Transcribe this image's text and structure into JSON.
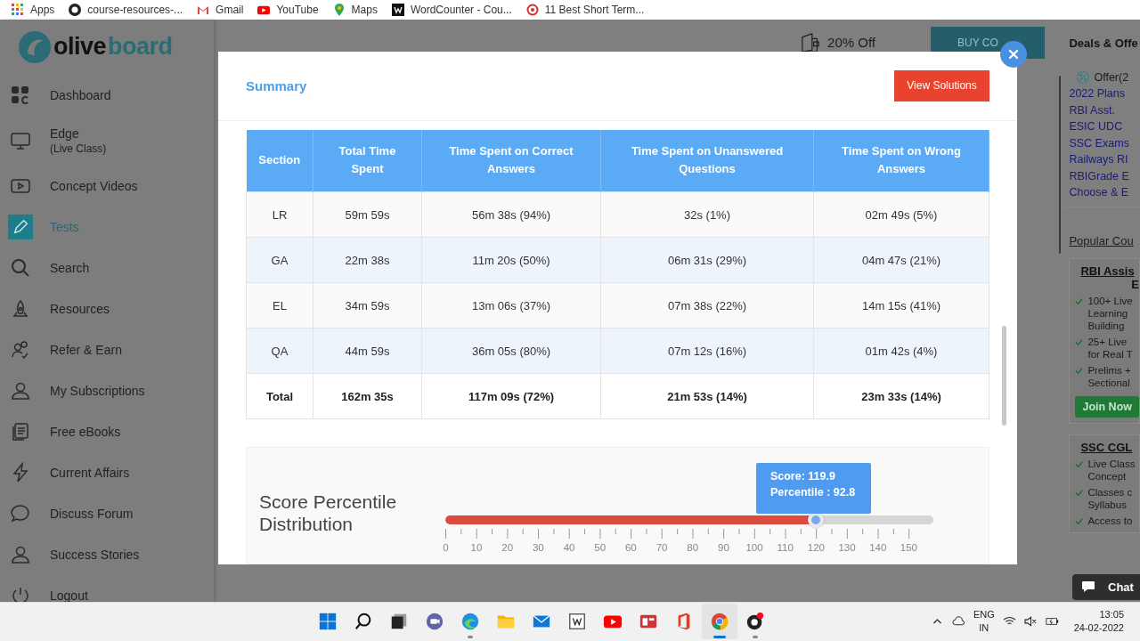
{
  "bookmarks": [
    {
      "label": "Apps",
      "kind": "apps"
    },
    {
      "label": "course-resources-...",
      "kind": "github"
    },
    {
      "label": "Gmail",
      "kind": "gmail"
    },
    {
      "label": "YouTube",
      "kind": "youtube"
    },
    {
      "label": "Maps",
      "kind": "maps"
    },
    {
      "label": "WordCounter - Cou...",
      "kind": "wordcounter"
    },
    {
      "label": "11 Best Short Term...",
      "kind": "target"
    }
  ],
  "logo": [
    "olive",
    "board"
  ],
  "sidebar": {
    "items": [
      {
        "label": "Dashboard",
        "kind": "grid",
        "selected": false
      },
      {
        "label": "Edge",
        "sublabel": "(Live Class)",
        "kind": "monitor",
        "selected": false
      },
      {
        "label": "Concept Videos",
        "kind": "video",
        "selected": false
      },
      {
        "label": "Tests",
        "kind": "pencil",
        "selected": true
      },
      {
        "label": "Search",
        "kind": "search",
        "selected": false
      },
      {
        "label": "Resources",
        "kind": "rocket",
        "selected": false
      },
      {
        "label": "Refer & Earn",
        "kind": "people",
        "selected": false
      },
      {
        "label": "My Subscriptions",
        "kind": "person",
        "selected": false
      },
      {
        "label": "Free eBooks",
        "kind": "book",
        "selected": false
      },
      {
        "label": "Current Affairs",
        "kind": "bolt",
        "selected": false
      },
      {
        "label": "Discuss Forum",
        "kind": "chat",
        "selected": false
      },
      {
        "label": "Success Stories",
        "kind": "person",
        "selected": false
      },
      {
        "label": "Logout",
        "kind": "power",
        "selected": false
      }
    ]
  },
  "topbar": {
    "offer": "20% Off",
    "buy_button": "BUY CO"
  },
  "right_panel": {
    "title": "Deals & Offe",
    "offers": [
      "Offer(2",
      "2022 Plans",
      "RBI Asst.",
      "ESIC UDC",
      "SSC Exams",
      "Railways RI",
      "RBIGrade E",
      "Choose & E"
    ],
    "popular_title": "Popular Cou",
    "courses": [
      {
        "title": "RBI Assis",
        "subtitle": "E",
        "features": [
          "100+ Live Learning Building",
          "25+ Live for Real T",
          "Prelims + Sectional"
        ],
        "button": "Join Now"
      },
      {
        "title": "SSC CGL",
        "features": [
          "Live Class Concept",
          "Classes c Syllabus",
          "Access to"
        ]
      }
    ],
    "chat_button": "Chat"
  },
  "modal": {
    "title": "Summary",
    "action_button": "View Solutions",
    "table": {
      "columns": [
        "Section",
        "Total Time Spent",
        "Time Spent on Correct Answers",
        "Time Spent on Unanswered Questions",
        "Time Spent on Wrong Answers"
      ],
      "rows": [
        {
          "kind": "section",
          "cells": [
            "LR",
            "59m 59s",
            "56m 38s (94%)",
            "32s (1%)",
            "02m 49s (5%)"
          ]
        },
        {
          "kind": "section",
          "cells": [
            "GA",
            "22m 38s",
            "11m 20s (50%)",
            "06m 31s (29%)",
            "04m 47s (21%)"
          ]
        },
        {
          "kind": "section",
          "cells": [
            "EL",
            "34m 59s",
            "13m 06s (37%)",
            "07m 38s (22%)",
            "14m 15s (41%)"
          ]
        },
        {
          "kind": "section",
          "cells": [
            "QA",
            "44m 59s",
            "36m 05s (80%)",
            "07m 12s (16%)",
            "01m 42s (4%)"
          ]
        },
        {
          "kind": "total",
          "cells": [
            "Total",
            "162m 35s",
            "117m 09s (72%)",
            "21m 53s (14%)",
            "23m 33s (14%)"
          ]
        }
      ]
    },
    "distribution": {
      "title": "Score Percentile Distribution",
      "level": 0.759,
      "tooltip": [
        "Score: 119.9",
        "Percentile : 92.8"
      ],
      "ticks": [
        "0",
        "10",
        "20",
        "30",
        "40",
        "50",
        "60",
        "70",
        "80",
        "90",
        "100",
        "110",
        "120",
        "130",
        "140",
        "150"
      ]
    }
  },
  "taskbar": {
    "apps": [
      {
        "kind": "start",
        "open": false,
        "selected": false
      },
      {
        "kind": "search",
        "open": false,
        "selected": false
      },
      {
        "kind": "taskview",
        "open": false,
        "selected": false
      },
      {
        "kind": "teams",
        "open": false,
        "selected": false
      },
      {
        "kind": "edge",
        "open": true,
        "selected": false
      },
      {
        "kind": "files",
        "open": false,
        "selected": false
      },
      {
        "kind": "mail",
        "open": false,
        "selected": false
      },
      {
        "kind": "wiki",
        "open": false,
        "selected": false
      },
      {
        "kind": "youtube",
        "open": false,
        "selected": false
      },
      {
        "kind": "news",
        "open": false,
        "selected": false
      },
      {
        "kind": "office",
        "open": false,
        "selected": false
      },
      {
        "kind": "chrome",
        "open": true,
        "selected": true
      },
      {
        "kind": "obs",
        "open": true,
        "selected": false
      }
    ],
    "lang": "ENG",
    "region": "IN",
    "time": "13:05",
    "date": "24-02-2022"
  }
}
